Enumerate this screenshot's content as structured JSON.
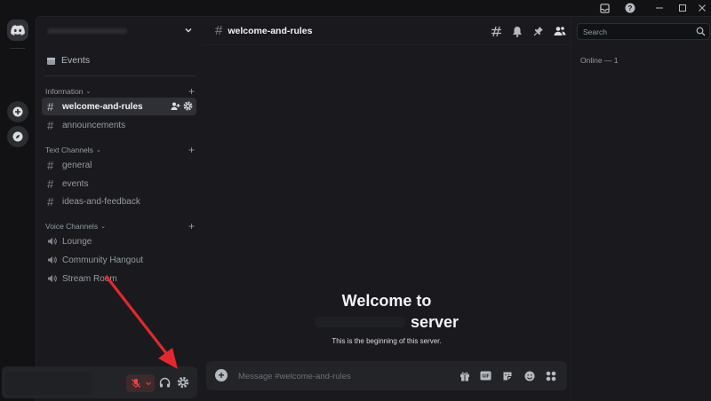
{
  "server": {
    "events_label": "Events",
    "categories": [
      {
        "name": "Information",
        "channels": [
          "welcome-and-rules",
          "announcements"
        ]
      },
      {
        "name": "Text Channels",
        "channels": [
          "general",
          "events",
          "ideas-and-feedback"
        ]
      },
      {
        "name": "Voice Channels",
        "channels": [
          "Lounge",
          "Community Hangout",
          "Stream Room"
        ]
      }
    ],
    "hash_glyph": "#",
    "plus_glyph": "+",
    "chevron_glyph": "⌄"
  },
  "chat": {
    "channel_name": "welcome-and-rules",
    "welcome_line1": "Welcome to",
    "welcome_line2": "server",
    "beginning_text": "This is the beginning of this server.",
    "composer_placeholder": "Message #welcome-and-rules",
    "plus_glyph": "+"
  },
  "members": {
    "search_placeholder": "Search",
    "online_label": "Online — 1"
  },
  "colors": {
    "annotation_arrow": "#e0282e",
    "mute_red": "#f23f43",
    "accent": "#5865f2"
  }
}
